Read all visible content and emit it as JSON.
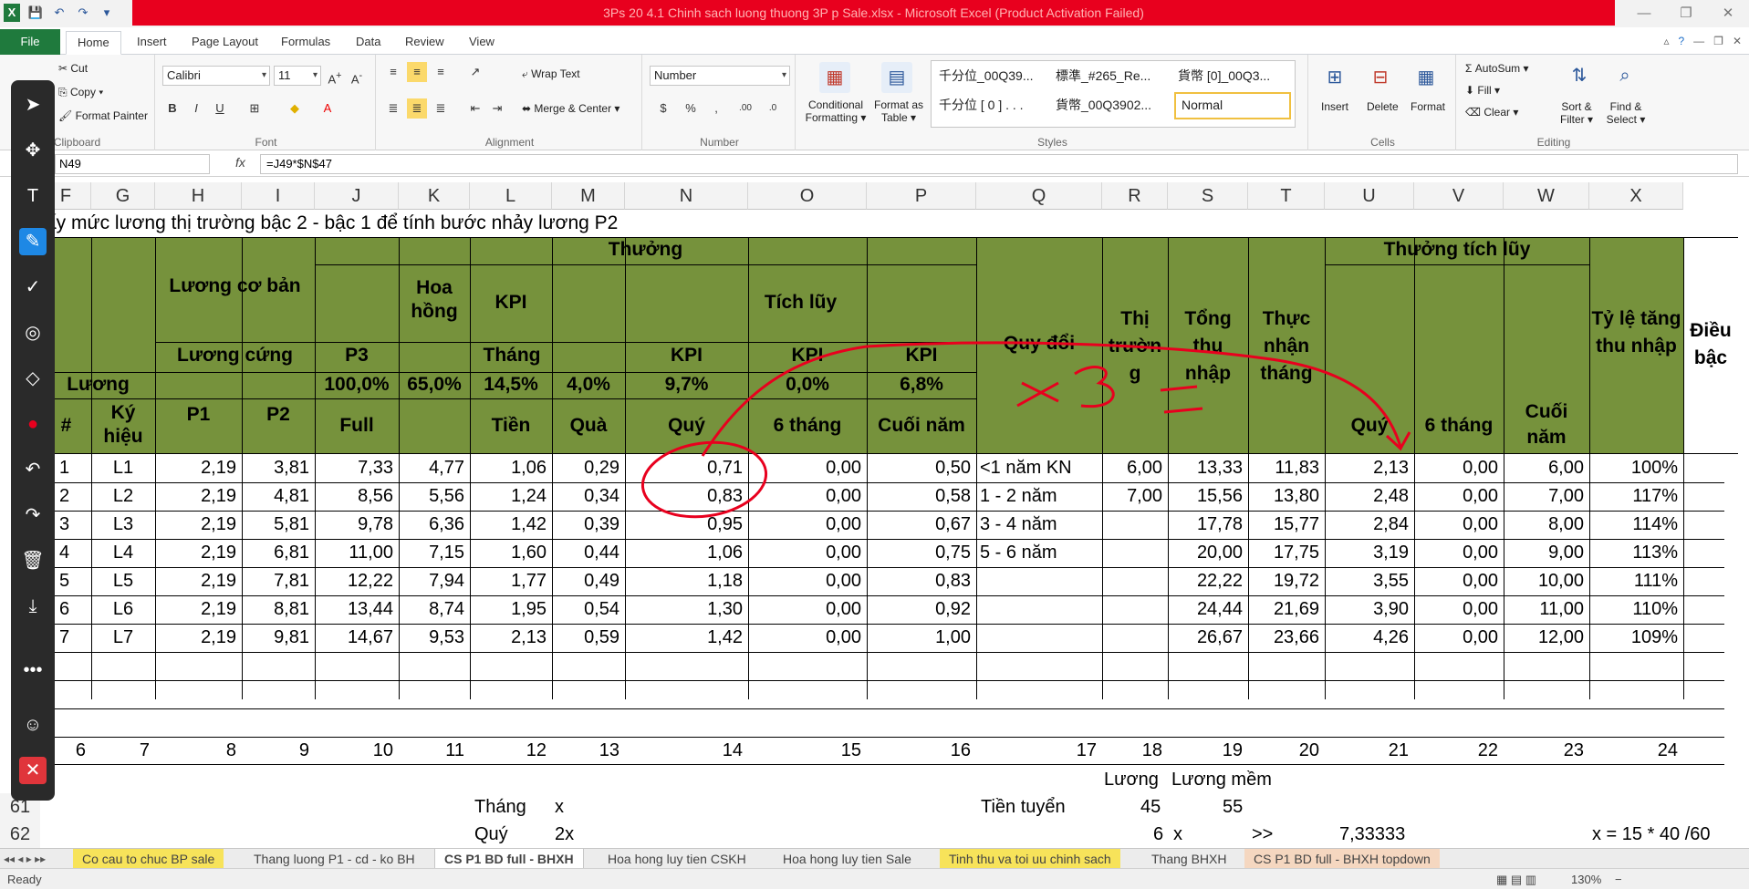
{
  "window": {
    "title": "3Ps 20 4.1 Chinh sach luong thuong 3P p Sale.xlsx - Microsoft Excel (Product Activation Failed)"
  },
  "ribbon_tabs": [
    "File",
    "Home",
    "Insert",
    "Page Layout",
    "Formulas",
    "Data",
    "Review",
    "View"
  ],
  "clipboard": {
    "cut": "Cut",
    "copy": "Copy ▾",
    "format_painter": "Format Painter",
    "label": "Clipboard"
  },
  "font": {
    "name": "Calibri",
    "size": "11",
    "label": "Font"
  },
  "alignment": {
    "wrap": "Wrap Text",
    "merge": "Merge & Center ▾",
    "label": "Alignment"
  },
  "number": {
    "format": "Number",
    "label": "Number"
  },
  "styles": {
    "conditional": "Conditional Formatting ▾",
    "format_table": "Format as Table ▾",
    "s1": "千分位_00Q39...",
    "s2": "標準_#265_Re...",
    "s3": "貨幣 [0]_00Q3...",
    "s4": "千分位 [ 0 ] . . .",
    "s5": "貨幣_00Q3902...",
    "normal": "Normal",
    "label": "Styles"
  },
  "cells_group": {
    "insert": "Insert",
    "delete": "Delete",
    "format": "Format",
    "label": "Cells"
  },
  "editing": {
    "autosum": "AutoSum ▾",
    "fill": "Fill ▾",
    "clear": "Clear ▾",
    "sort": "Sort & Filter ▾",
    "find": "Find & Select ▾",
    "label": "Editing"
  },
  "formula_bar": {
    "cell_ref": "N49",
    "fx": "fx",
    "formula": "=J49*$N$47"
  },
  "columns": [
    "F",
    "G",
    "H",
    "I",
    "J",
    "K",
    "L",
    "M",
    "N",
    "O",
    "P",
    "Q",
    "R",
    "S",
    "T",
    "U",
    "V",
    "W",
    "X"
  ],
  "sheet": {
    "title_text": "ấy mức lương thị trường bậc 2 - bậc 1 để tính bước nhảy lương P2",
    "headers": {
      "thuong": "Thưởng",
      "luong_co_ban": "Lương cơ bản",
      "luong_cung": "Lương cứng",
      "hoa_hong": "Hoa hồng",
      "kpi": "KPI",
      "tich_luy": "Tích lũy",
      "p3": "P3",
      "thang": "Tháng",
      "kpi_a": "KPI",
      "kpi_b": "KPI",
      "kpi_c": "KPI",
      "luong": "Lương",
      "pct_100": "100,0%",
      "pct_65": "65,0%",
      "pct_14": "14,5%",
      "pct_4": "4,0%",
      "pct_9": "9,7%",
      "pct_0": "0,0%",
      "pct_6": "6,8%",
      "hash": "#",
      "ky_hieu": "Ký hiệu",
      "p1": "P1",
      "p2": "P2",
      "full": "Full",
      "tien": "Tiền",
      "qua": "Quà",
      "quy": "Quý",
      "six_thang": "6 tháng",
      "cuoi_nam": "Cuối năm",
      "quy_doi": "Quy đổi",
      "thi_truong": "Thị trườn g",
      "tong_thu_nhap": "Tổng thu nhập",
      "thuc_nhan_thang": "Thực nhận tháng",
      "thuong_tich_luy": "Thưởng tích lũy",
      "quy2": "Quý",
      "six_thang2": "6 tháng",
      "cuoi_nam2": "Cuối năm",
      "ty_le": "Tỷ lệ tăng thu nhập",
      "dieu_bac": "Điều bậc"
    },
    "rows": [
      [
        "1",
        "L1",
        "2,19",
        "3,81",
        "7,33",
        "4,77",
        "1,06",
        "0,29",
        "0,71",
        "0,00",
        "0,50",
        "<1 năm KN",
        "6,00",
        "13,33",
        "11,83",
        "2,13",
        "0,00",
        "6,00",
        "100%"
      ],
      [
        "2",
        "L2",
        "2,19",
        "4,81",
        "8,56",
        "5,56",
        "1,24",
        "0,34",
        "0,83",
        "0,00",
        "0,58",
        "1 - 2 năm",
        "7,00",
        "15,56",
        "13,80",
        "2,48",
        "0,00",
        "7,00",
        "117%"
      ],
      [
        "3",
        "L3",
        "2,19",
        "5,81",
        "9,78",
        "6,36",
        "1,42",
        "0,39",
        "0,95",
        "0,00",
        "0,67",
        "3 - 4 năm",
        "",
        "17,78",
        "15,77",
        "2,84",
        "0,00",
        "8,00",
        "114%"
      ],
      [
        "4",
        "L4",
        "2,19",
        "6,81",
        "11,00",
        "7,15",
        "1,60",
        "0,44",
        "1,06",
        "0,00",
        "0,75",
        "5 - 6 năm",
        "",
        "20,00",
        "17,75",
        "3,19",
        "0,00",
        "9,00",
        "113%"
      ],
      [
        "5",
        "L5",
        "2,19",
        "7,81",
        "12,22",
        "7,94",
        "1,77",
        "0,49",
        "1,18",
        "0,00",
        "0,83",
        "",
        "",
        "22,22",
        "19,72",
        "3,55",
        "0,00",
        "10,00",
        "111%"
      ],
      [
        "6",
        "L6",
        "2,19",
        "8,81",
        "13,44",
        "8,74",
        "1,95",
        "0,54",
        "1,30",
        "0,00",
        "0,92",
        "",
        "",
        "24,44",
        "21,69",
        "3,90",
        "0,00",
        "11,00",
        "110%"
      ],
      [
        "7",
        "L7",
        "2,19",
        "9,81",
        "14,67",
        "9,53",
        "2,13",
        "0,59",
        "1,42",
        "0,00",
        "1,00",
        "",
        "",
        "26,67",
        "23,66",
        "4,26",
        "0,00",
        "12,00",
        "109%"
      ]
    ],
    "index_row": [
      "6",
      "7",
      "8",
      "9",
      "10",
      "11",
      "12",
      "13",
      "14",
      "15",
      "16",
      "17",
      "18",
      "19",
      "20",
      "21",
      "22",
      "23",
      "24"
    ],
    "extra": {
      "luong": "Lương",
      "luong_mem": "Lương mềm",
      "r61": "61",
      "r62": "62",
      "thang": "Tháng",
      "x": "x",
      "tien_tuyen": "Tiền tuyển",
      "n45": "45",
      "n55": "55",
      "quy": "Quý",
      "x2": "2x",
      "n6": "6",
      "x3": "x",
      "gtgt": ">>",
      "val": "7,33333",
      "formula_note": "x = 15 * 40 /60"
    },
    "annotation_text": "x 3 ="
  },
  "sheet_tabs": [
    "Co cau to chuc BP sale",
    "Thang luong P1 - cd - ko BH",
    "CS P1 BD full - BHXH",
    "Hoa hong luy tien CSKH",
    "Hoa hong luy tien Sale",
    "Tinh thu va toi uu chinh sach",
    "Thang BHXH",
    "CS P1 BD full - BHXH topdown"
  ],
  "status": {
    "ready": "Ready",
    "zoom": "130%"
  },
  "colors": {
    "header_green": "#76923c",
    "title_red": "#e8001e",
    "ink": "#e8001e",
    "file_tab": "#1f7a3d"
  },
  "pen_tools": [
    "cursor-icon",
    "move-icon",
    "text-icon",
    "pen-icon",
    "check-icon",
    "target-icon",
    "eraser-icon",
    "record-icon",
    "undo-icon",
    "redo-icon",
    "trash-icon",
    "download-icon",
    "more-icon",
    "person-icon",
    "close-icon"
  ]
}
